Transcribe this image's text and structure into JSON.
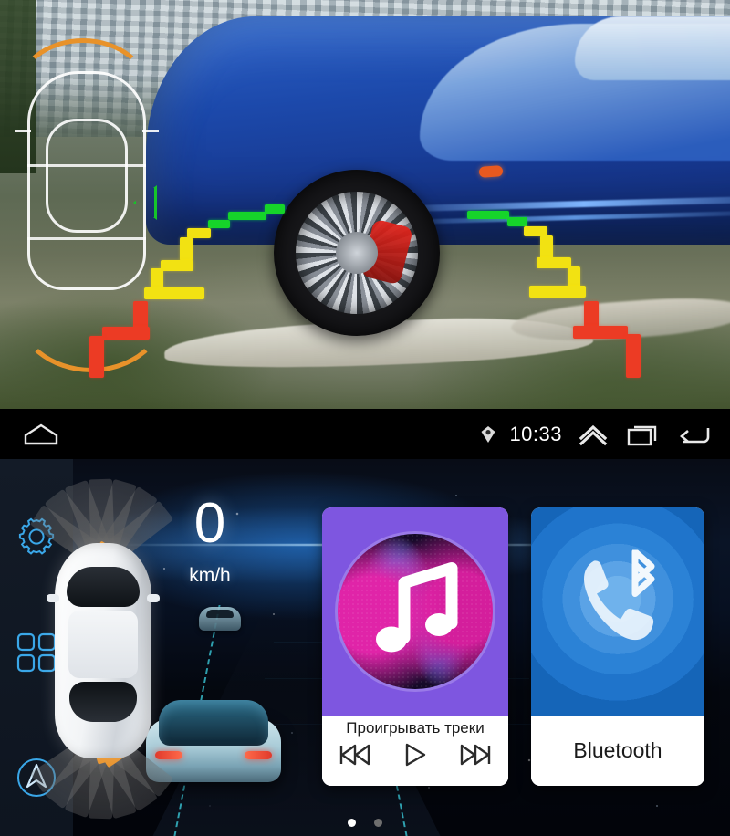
{
  "camera": {
    "label": "rear-view camera feed",
    "guideline_colors": {
      "near": "#ec3b24",
      "mid": "#f2e212",
      "far": "#16d42a",
      "arc": "#e8922a",
      "outline": "#ffffff"
    }
  },
  "statusbar": {
    "home_icon": "home-icon",
    "gps_icon": "gps-location-icon",
    "time": "10:33",
    "expand_icon": "chevron-up-icon",
    "recents_icon": "recent-apps-icon",
    "back_icon": "back-arrow-icon"
  },
  "sidebar": {
    "items": [
      {
        "name": "settings",
        "icon": "gear-icon"
      },
      {
        "name": "all-apps",
        "icon": "apps-grid-icon"
      },
      {
        "name": "navigation",
        "icon": "navigation-compass-icon"
      }
    ],
    "accent": "#3aa7e8"
  },
  "dashboard": {
    "speed_value": "0",
    "speed_unit": "km/h",
    "radar_alert_color": "#ff3c10",
    "radar_warn_color": "#e8922a"
  },
  "widgets": {
    "music": {
      "title": "Проигрывать треки",
      "card_color": "#7e56e0",
      "icon": "music-note-icon",
      "controls": [
        {
          "name": "previous-track",
          "icon": "skip-previous-icon"
        },
        {
          "name": "play",
          "icon": "play-icon"
        },
        {
          "name": "next-track",
          "icon": "skip-next-icon"
        }
      ]
    },
    "bluetooth": {
      "title": "Bluetooth",
      "card_color": "#2b82d6",
      "icon": "bluetooth-phone-icon"
    }
  },
  "pager": {
    "pages": [
      {
        "active": true,
        "color": "#ffffff"
      },
      {
        "active": false,
        "color": "#6e6e6e"
      }
    ]
  }
}
